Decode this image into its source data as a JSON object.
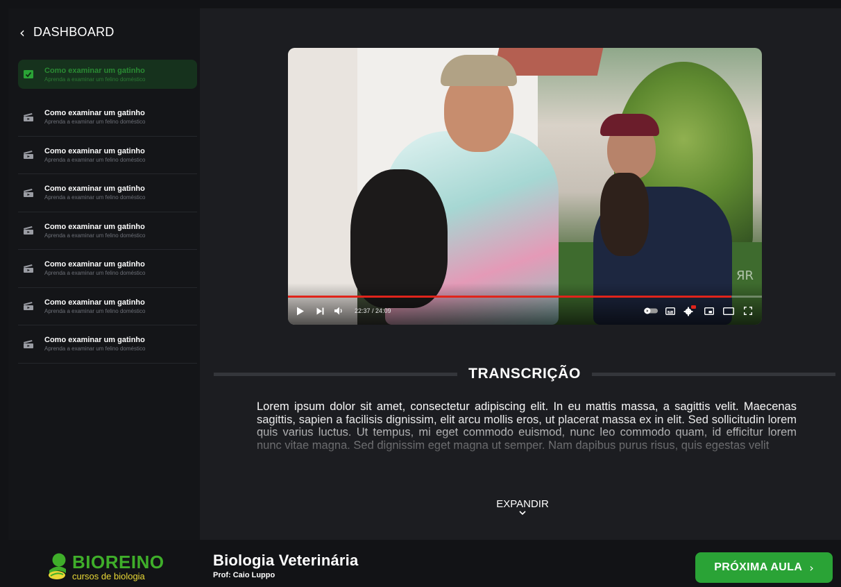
{
  "sidebar": {
    "back_label": "DASHBOARD",
    "lessons": [
      {
        "title": "Como examinar um gatinho",
        "subtitle": "Aprenda a examinar um felino doméstico",
        "active": true
      },
      {
        "title": "Como examinar um gatinho",
        "subtitle": "Aprenda a examinar um felino doméstico",
        "active": false
      },
      {
        "title": "Como examinar um gatinho",
        "subtitle": "Aprenda a examinar um felino doméstico",
        "active": false
      },
      {
        "title": "Como examinar um gatinho",
        "subtitle": "Aprenda a examinar um felino doméstico",
        "active": false
      },
      {
        "title": "Como examinar um gatinho",
        "subtitle": "Aprenda a examinar um felino doméstico",
        "active": false
      },
      {
        "title": "Como examinar um gatinho",
        "subtitle": "Aprenda a examinar um felino doméstico",
        "active": false
      },
      {
        "title": "Como examinar um gatinho",
        "subtitle": "Aprenda a examinar um felino doméstico",
        "active": false
      },
      {
        "title": "Como examinar um gatinho",
        "subtitle": "Aprenda a examinar um felino doméstico",
        "active": false
      }
    ]
  },
  "video": {
    "time_display": "22:37 / 24:09",
    "progress": 0.936,
    "watermark": "ЯR"
  },
  "transcript": {
    "title": "TRANSCRIÇÃO",
    "text": "Lorem ipsum dolor sit amet, consectetur adipiscing elit. In eu mattis massa, a sagittis velit. Maecenas sagittis, sapien a facilisis dignissim, elit arcu mollis eros, ut placerat massa ex in elit. Sed sollicitudin lorem quis varius luctus. Ut tempus, mi eget commodo euismod, nunc leo commodo quam, id efficitur lorem nunc vitae magna. Sed dignissim eget magna ut semper. Nam dapibus purus risus, quis egestas velit",
    "expand_label": "EXPANDIR"
  },
  "footer": {
    "brand": "BIOREINO",
    "brand_sub": "cursos de biologia",
    "course_title": "Biologia Veterinária",
    "course_prof": "Prof: Caio Luppo",
    "next_label": "PRÓXIMA AULA"
  },
  "colors": {
    "accent": "#2aa336",
    "progress": "#e0241b",
    "brand_green": "#3fae2a",
    "brand_yellow": "#e9d836"
  }
}
